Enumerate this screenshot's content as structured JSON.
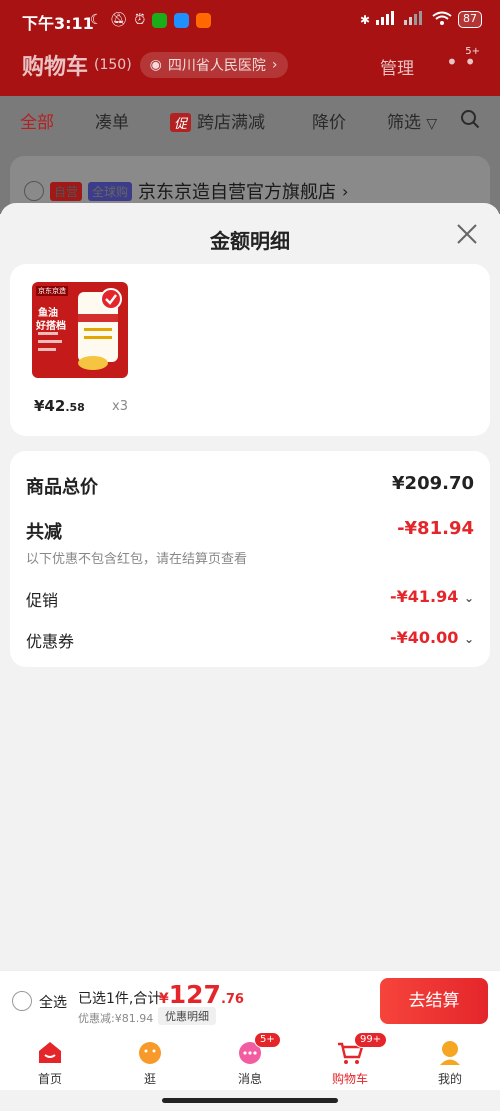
{
  "status_bar": {
    "time": "下午3:11",
    "battery": "87"
  },
  "header": {
    "title": "购物车",
    "count": "(150)",
    "location": "四川省人民医院",
    "manage": "管理",
    "more_badge": "5+"
  },
  "filters": {
    "all": "全部",
    "bundle": "凑单",
    "cross_store_badge": "促",
    "cross_store": "跨店满减",
    "price_drop": "降价",
    "filter": "筛选"
  },
  "shop": {
    "tag_self": "自营",
    "tag_global": "全球购",
    "name": "京东京造自营官方旗舰店",
    "arrow": "›"
  },
  "sheet": {
    "title": "金额明细"
  },
  "product": {
    "price_yuan": "¥42",
    "price_cents": ".58",
    "qty": "x3",
    "img_brand": "京东京造",
    "img_line1": "鱼油",
    "img_line2": "好搭档"
  },
  "breakdown": {
    "total_label": "商品总价",
    "total_value": "¥209.70",
    "reduce_label": "共减",
    "reduce_value": "-¥81.94",
    "note": "以下优惠不包含红包，请在结算页查看",
    "promo_label": "促销",
    "promo_value": "-¥41.94",
    "coupon_label": "优惠券",
    "coupon_value": "-¥40.00"
  },
  "checkout": {
    "select_all": "全选",
    "selected_text": "已选1件,合计:",
    "total_symbol": "¥",
    "total_int": "127",
    "total_dec": ".76",
    "discount_text": "优惠减:¥81.94",
    "detail_btn": "优惠明细",
    "checkout_btn": "去结算"
  },
  "tabs": [
    {
      "label": "首页"
    },
    {
      "label": "逛"
    },
    {
      "label": "消息",
      "badge": "5+"
    },
    {
      "label": "购物车",
      "badge": "99+"
    },
    {
      "label": "我的"
    }
  ],
  "colors": {
    "brand_red": "#e4262b",
    "header_red": "#a81212"
  }
}
